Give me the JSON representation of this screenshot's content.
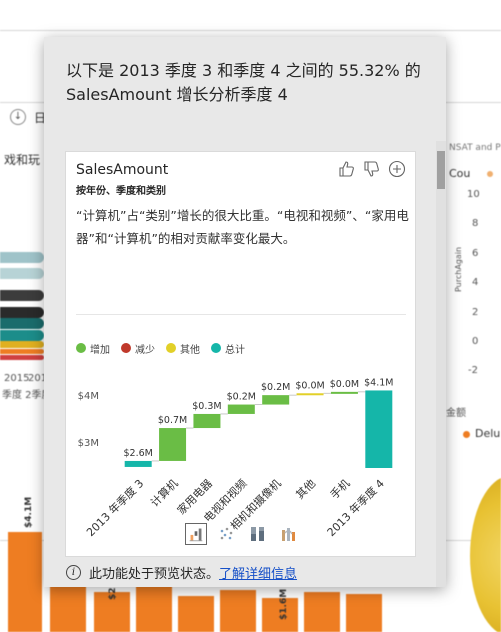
{
  "background": {
    "left_panel_text": "戏和玩",
    "left_axis_years": [
      "2015",
      "2019"
    ],
    "left_axis_quarter": "季度 2季度",
    "header_fragment": "日",
    "right_header": "NSAT and P",
    "right_legend": "Cou",
    "right_axis_title": "PurchAgain",
    "right_ticks": [
      "10",
      "8",
      "6",
      "4",
      "2",
      "0",
      "-2"
    ],
    "right_amount_label": "金额",
    "right_legend2": "Delu",
    "bottom_bar_labels": [
      "$4.1M",
      "$2",
      "$1.6M"
    ],
    "colors": {
      "accent": "#ee7d22"
    }
  },
  "popup": {
    "title": "以下是 2013 季度 3 和季度 4 之间的 55.32% 的 SalesAmount 增长分析季度 4",
    "card": {
      "title": "SalesAmount",
      "subtitle": "按年份、季度和类别",
      "icons": [
        "thumbs-up-icon",
        "thumbs-down-icon",
        "add-icon"
      ],
      "description": "“计算机”占“类别”增长的很大比重。“电视和视频”、“家用电器”和“计算机”的相对贡献率变化最大。",
      "viz_types": [
        "waterfall-icon",
        "scatter-icon",
        "column-icon",
        "ribbon-icon"
      ]
    },
    "footer": {
      "text": "此功能处于预览状态。",
      "link": "了解详细信息"
    }
  },
  "chart_data": {
    "type": "waterfall",
    "legend": [
      {
        "label": "增加",
        "color": "#6abd45"
      },
      {
        "label": "减少",
        "color": "#c0392b"
      },
      {
        "label": "其他",
        "color": "#e2d028"
      },
      {
        "label": "总计",
        "color": "#15b6a9"
      }
    ],
    "y_ticks": [
      {
        "value": 3,
        "label": "$3M"
      },
      {
        "value": 4,
        "label": "$4M"
      }
    ],
    "ylim": [
      2.45,
      4.45
    ],
    "categories": [
      "2013 年季度 3",
      "计算机",
      "家用电器",
      "电视和视频",
      "相机和摄像机",
      "其他",
      "手机",
      "2013 年季度 4"
    ],
    "bars": [
      {
        "kind": "total",
        "start": 0,
        "end": 2.6,
        "label": "$2.6M"
      },
      {
        "kind": "increase",
        "start": 2.6,
        "end": 3.3,
        "label": "$0.7M"
      },
      {
        "kind": "increase",
        "start": 3.3,
        "end": 3.6,
        "label": "$0.3M"
      },
      {
        "kind": "increase",
        "start": 3.6,
        "end": 3.8,
        "label": "$0.2M"
      },
      {
        "kind": "increase",
        "start": 3.8,
        "end": 4.0,
        "label": "$0.2M"
      },
      {
        "kind": "other",
        "start": 4.0,
        "end": 4.04,
        "label": "$0.0M"
      },
      {
        "kind": "increase",
        "start": 4.04,
        "end": 4.07,
        "label": "$0.0M"
      },
      {
        "kind": "total",
        "start": 0,
        "end": 4.1,
        "label": "$4.1M"
      }
    ]
  }
}
